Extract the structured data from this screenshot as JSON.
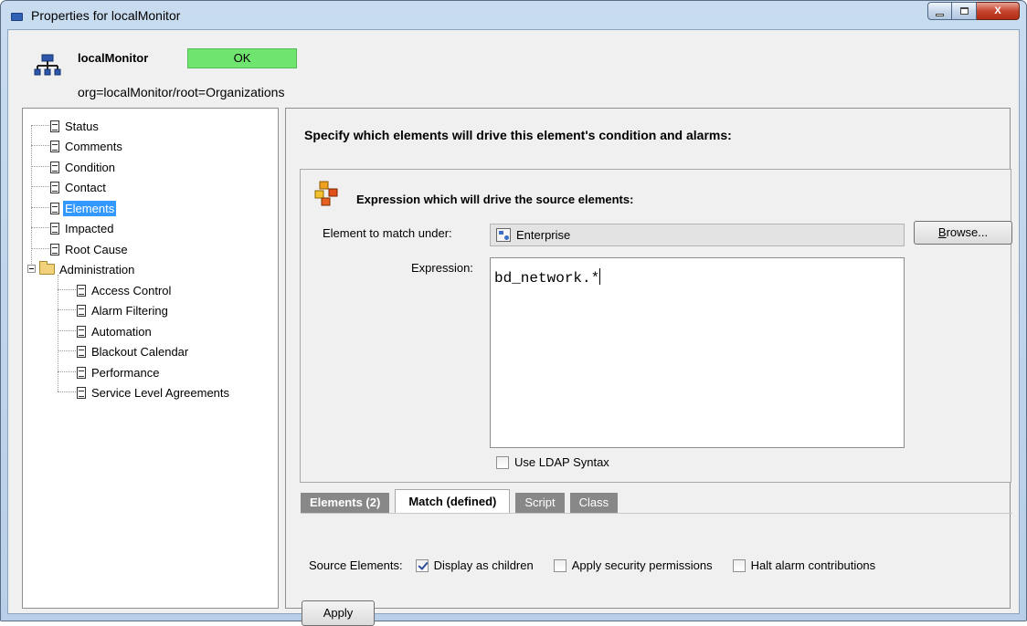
{
  "window": {
    "title": "Properties for localMonitor",
    "controls": {
      "minimize": "minimize-icon",
      "maximize": "maximize-icon",
      "close": "X"
    }
  },
  "header": {
    "name": "localMonitor",
    "status": "OK",
    "path": "org=localMonitor/root=Organizations",
    "status_color": "#6fe46f"
  },
  "tree": {
    "items": [
      {
        "label": "Status"
      },
      {
        "label": "Comments"
      },
      {
        "label": "Condition"
      },
      {
        "label": "Contact"
      },
      {
        "label": "Elements",
        "selected": true
      },
      {
        "label": "Impacted"
      },
      {
        "label": "Root Cause"
      },
      {
        "label": "Administration",
        "type": "folder",
        "expanded": true
      },
      {
        "label": "Access Control"
      },
      {
        "label": "Alarm Filtering"
      },
      {
        "label": "Automation"
      },
      {
        "label": "Blackout Calendar"
      },
      {
        "label": "Performance"
      },
      {
        "label": "Service Level Agreements"
      }
    ]
  },
  "main": {
    "heading": "Specify which elements will drive this element's condition and alarms:",
    "expression_section": {
      "title": "Expression which will drive the source elements:",
      "match_label": "Element to match under:",
      "match_value": "Enterprise",
      "browse_label_u": "B",
      "browse_label_rest": "rowse...",
      "expression_label": "Expression:",
      "expression_value": "bd_network.*",
      "ldap_label": "Use LDAP Syntax",
      "ldap_checked": false
    },
    "tabs": [
      {
        "label": "Elements (2)",
        "active": false
      },
      {
        "label": "Match (defined)",
        "active": true
      },
      {
        "label": "Script",
        "active": false
      },
      {
        "label": "Class",
        "active": false
      }
    ],
    "source_elements": {
      "label": "Source Elements:",
      "options": [
        {
          "label": "Display as children",
          "checked": true
        },
        {
          "label": "Apply security permissions",
          "checked": false
        },
        {
          "label": "Halt alarm contributions",
          "checked": false
        }
      ]
    },
    "apply_label": "Apply"
  }
}
